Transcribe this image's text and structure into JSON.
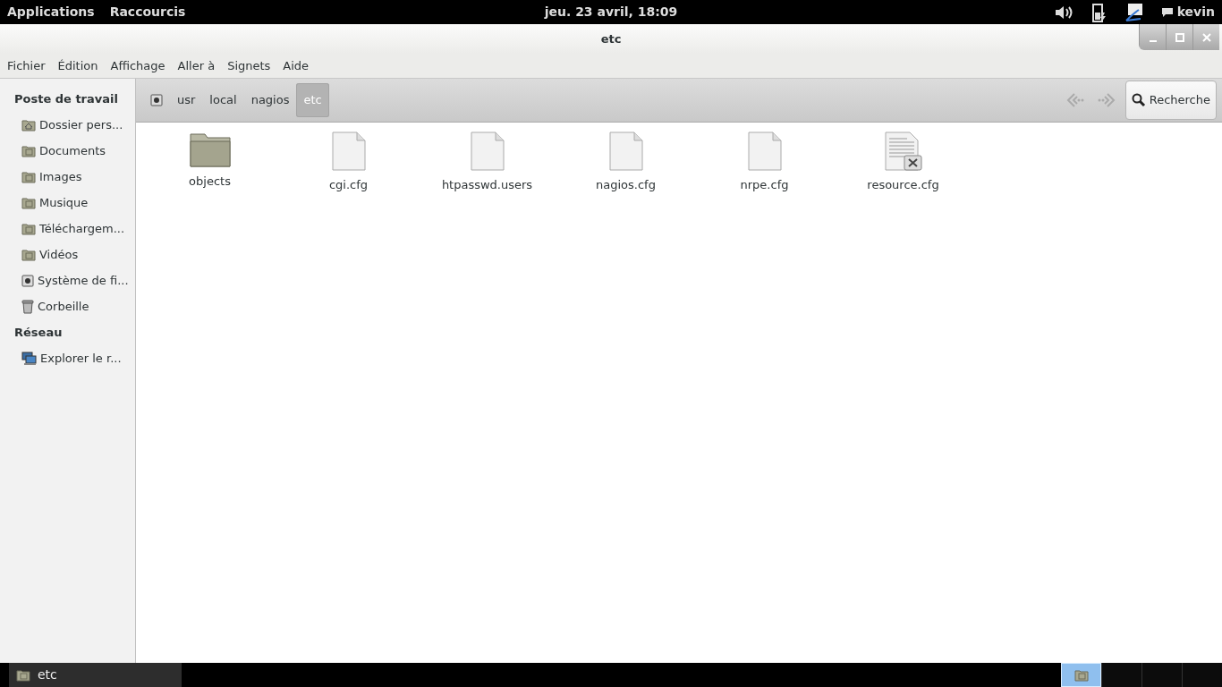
{
  "top_bar": {
    "menus": [
      "Applications",
      "Raccourcis"
    ],
    "clock": "jeu. 23 avril, 18:09",
    "user": "kevin"
  },
  "window": {
    "title": "etc"
  },
  "menu_bar": [
    "Fichier",
    "Édition",
    "Affichage",
    "Aller à",
    "Signets",
    "Aide"
  ],
  "sidebar": [
    {
      "heading": "Poste de travail",
      "items": [
        {
          "label": "Dossier pers...",
          "kind": "home",
          "selected": false
        },
        {
          "label": "Documents",
          "kind": "folder",
          "selected": false
        },
        {
          "label": "Images",
          "kind": "folder",
          "selected": false
        },
        {
          "label": "Musique",
          "kind": "folder",
          "selected": false
        },
        {
          "label": "Téléchargem...",
          "kind": "folder",
          "selected": false
        },
        {
          "label": "Vidéos",
          "kind": "folder",
          "selected": false
        },
        {
          "label": "Système de fi...",
          "kind": "drive",
          "selected": false
        },
        {
          "label": "Corbeille",
          "kind": "trash",
          "selected": false
        }
      ]
    },
    {
      "heading": "Réseau",
      "items": [
        {
          "label": "Explorer le r...",
          "kind": "network",
          "selected": false
        }
      ]
    }
  ],
  "path_bar": [
    {
      "kind": "drive",
      "selected": false
    },
    {
      "label": "usr",
      "kind": "dir",
      "selected": false
    },
    {
      "label": "local",
      "kind": "dir",
      "selected": false
    },
    {
      "label": "nagios",
      "kind": "dir",
      "selected": false
    },
    {
      "label": "etc",
      "kind": "dir",
      "selected": true
    }
  ],
  "search_button": "Recherche",
  "files": [
    {
      "name": "objects",
      "kind": "folder"
    },
    {
      "name": "cgi.cfg",
      "kind": "file"
    },
    {
      "name": "htpasswd.users",
      "kind": "file"
    },
    {
      "name": "nagios.cfg",
      "kind": "file"
    },
    {
      "name": "nrpe.cfg",
      "kind": "file"
    },
    {
      "name": "resource.cfg",
      "kind": "locked"
    }
  ],
  "taskbar": {
    "window_button": "etc",
    "workspaces": [
      {
        "selected": true
      },
      {
        "selected": false
      },
      {
        "selected": false
      },
      {
        "selected": false
      }
    ]
  }
}
